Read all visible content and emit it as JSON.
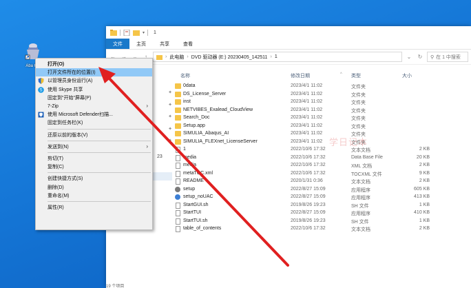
{
  "desktop_icon": {
    "label": "Aba Con"
  },
  "window": {
    "title": "1",
    "ribbon_tabs": [
      "文件",
      "主页",
      "共享",
      "查看"
    ],
    "address_parts": [
      "此电脑",
      "DVD 驱动器 (E:) 20230405_142511",
      "1"
    ],
    "search_placeholder": "在 1 中搜索",
    "columns": {
      "name": "名称",
      "date": "修改日期",
      "type": "类型",
      "size": "大小"
    },
    "files": [
      {
        "name": "0data",
        "date": "2023/4/1 11:02",
        "type": "文件夹",
        "size": "",
        "icon": "folder"
      },
      {
        "name": "DS_License_Server",
        "date": "2023/4/1 11:02",
        "type": "文件夹",
        "size": "",
        "icon": "folder"
      },
      {
        "name": "inst",
        "date": "2023/4/1 11:02",
        "type": "文件夹",
        "size": "",
        "icon": "folder"
      },
      {
        "name": "NETVIBES_Exalead_CloudView",
        "date": "2023/4/1 11:02",
        "type": "文件夹",
        "size": "",
        "icon": "folder"
      },
      {
        "name": "Search_Doc",
        "date": "2023/4/1 11:02",
        "type": "文件夹",
        "size": "",
        "icon": "folder"
      },
      {
        "name": "Setup.app",
        "date": "2023/4/1 11:02",
        "type": "文件夹",
        "size": "",
        "icon": "folder"
      },
      {
        "name": "SIMULIA_Abaqus_AI",
        "date": "2023/4/1 11:02",
        "type": "文件夹",
        "size": "",
        "icon": "folder"
      },
      {
        "name": "SIMULIA_FLEXnet_LicenseServer",
        "date": "2023/4/1 11:02",
        "type": "文件夹",
        "size": "",
        "icon": "folder"
      },
      {
        "name": "1",
        "date": "2022/10/6 17:32",
        "type": "文本文档",
        "size": "2 KB",
        "icon": "file"
      },
      {
        "name": "media",
        "date": "2022/10/6 17:32",
        "type": "Data Base File",
        "size": "20 KB",
        "icon": "file"
      },
      {
        "name": "media",
        "date": "2022/10/6 17:32",
        "type": "XML 文档",
        "size": "2 KB",
        "icon": "file"
      },
      {
        "name": "metaTOC.xml",
        "date": "2022/10/6 17:32",
        "type": "TOCXML 文件",
        "size": "9 KB",
        "icon": "file"
      },
      {
        "name": "README",
        "date": "2020/1/31 0:36",
        "type": "文本文档",
        "size": "2 KB",
        "icon": "file"
      },
      {
        "name": "setup",
        "date": "2022/8/27 15:09",
        "type": "应用程序",
        "size": "605 KB",
        "icon": "setup"
      },
      {
        "name": "setup_noUAC",
        "date": "2022/8/27 15:09",
        "type": "应用程序",
        "size": "413 KB",
        "icon": "app"
      },
      {
        "name": "StartGUI.sh",
        "date": "2019/8/26 19:23",
        "type": "SH 文件",
        "size": "1 KB",
        "icon": "file"
      },
      {
        "name": "StartTUI",
        "date": "2022/8/27 15:09",
        "type": "应用程序",
        "size": "410 KB",
        "icon": "file"
      },
      {
        "name": "StartTUI.sh",
        "date": "2019/8/26 19:23",
        "type": "SH 文件",
        "size": "1 KB",
        "icon": "file"
      },
      {
        "name": "table_of_contents",
        "date": "2022/10/6 17:32",
        "type": "文本文档",
        "size": "2 KB",
        "icon": "file"
      }
    ],
    "nav_number": "23",
    "status": "19 个项目"
  },
  "watermark": "学日记本",
  "context_menu": {
    "items": [
      {
        "label": "打开(O)",
        "bold": true
      },
      {
        "label": "打开文件所在的位置(I)",
        "highlight": true
      },
      {
        "label": "以管理员身份运行(A)",
        "icon": "shield-icon"
      },
      {
        "label": "使用 Skype 共享",
        "icon": "skype-icon"
      },
      {
        "label": "固定到\"开始\"屏幕(P)"
      },
      {
        "label": "7-Zip",
        "submenu": true
      },
      {
        "label": "使用 Microsoft Defender扫描...",
        "icon": "defender-icon"
      },
      {
        "label": "固定到任务栏(K)"
      },
      {
        "sep": true
      },
      {
        "label": "还原以前的版本(V)"
      },
      {
        "sep": true
      },
      {
        "label": "发送到(N)",
        "submenu": true
      },
      {
        "sep": true
      },
      {
        "label": "剪切(T)"
      },
      {
        "label": "复制(C)"
      },
      {
        "sep": true
      },
      {
        "label": "创建快捷方式(S)"
      },
      {
        "label": "删除(D)"
      },
      {
        "label": "重命名(M)"
      },
      {
        "sep": true
      },
      {
        "label": "属性(R)"
      }
    ]
  },
  "colors": {
    "arrow": "#e02020",
    "ribbon_active": "#1979ca",
    "menu_highlight": "#91c9f7",
    "folder": "#f5c548"
  }
}
